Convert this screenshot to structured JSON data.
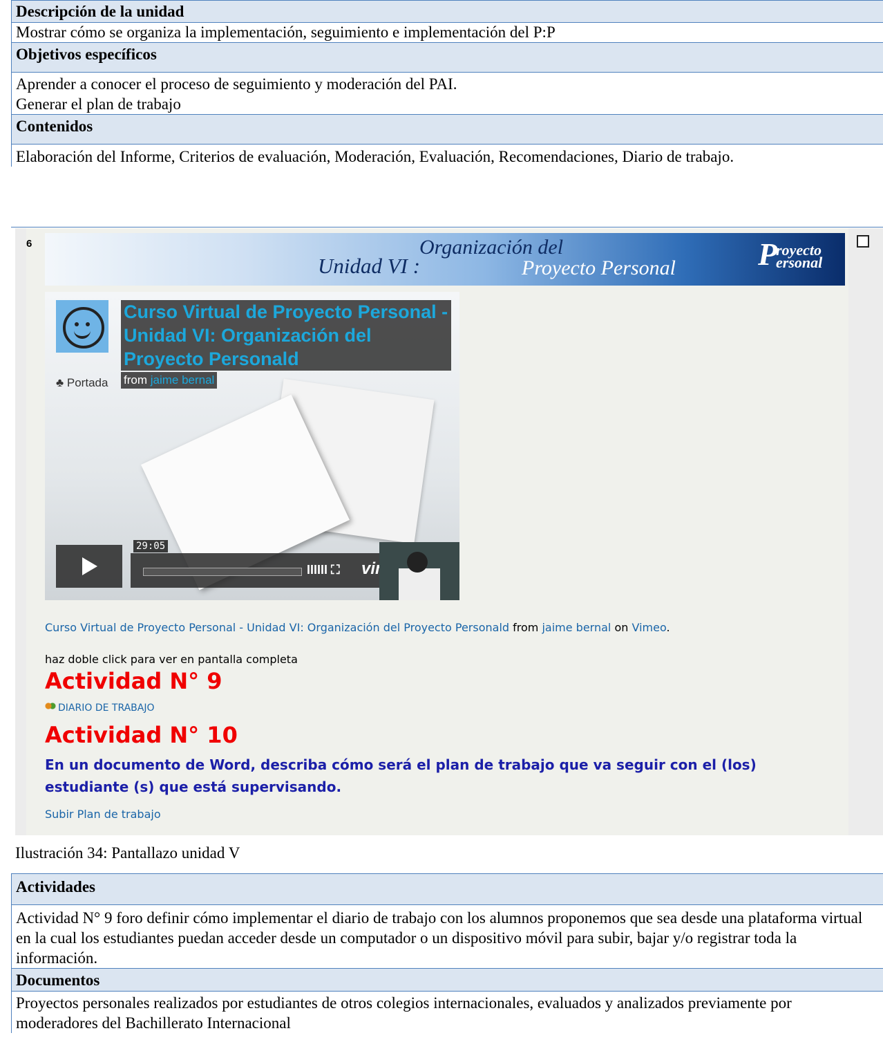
{
  "sections": {
    "descripcion": {
      "heading": "Descripción de la unidad",
      "body": "Mostrar cómo se organiza la implementación, seguimiento e implementación del P:P"
    },
    "objetivos": {
      "heading": "Objetivos específicos",
      "lines": [
        "Aprender a conocer el proceso de seguimiento y moderación del PAI.",
        "Generar el plan de trabajo"
      ]
    },
    "contenidos": {
      "heading": "Contenidos",
      "body": "Elaboración del Informe, Criterios de evaluación, Moderación, Evaluación, Recomendaciones, Diario de trabajo."
    },
    "actividades": {
      "heading": "Actividades",
      "body": "Actividad N° 9 foro definir cómo implementar el diario de trabajo con los alumnos proponemos que sea desde una plataforma virtual en la cual los estudiantes puedan acceder desde un computador o un dispositivo móvil para subir, bajar y/o registrar toda la información."
    },
    "documentos": {
      "heading": "Documentos",
      "body": "Proyectos personales realizados por estudiantes de otros colegios internacionales, evaluados y analizados previamente por moderadores del Bachillerato Internacional"
    }
  },
  "screenshot": {
    "section_number": "6",
    "banner": {
      "unidad": "Unidad VI :",
      "line1": "Organización del",
      "line2": "Proyecto Personal",
      "logo_p": "P",
      "logo_top": "royecto",
      "logo_bottom": "ersonal"
    },
    "video": {
      "title": "Curso Virtual de Proyecto Personal - Unidad VI: Organización del Proyecto Personald",
      "from_label": "from",
      "author": "jaime bernal",
      "portada": "Portada",
      "time": "29:05",
      "brand": "vimeo",
      "icons": "IIIIII ⛶"
    },
    "caption": {
      "link1": "Curso Virtual de Proyecto Personal - Unidad VI: Organización del Proyecto Personald",
      "from": "from",
      "author": "jaime bernal",
      "on": "on",
      "site": "Vimeo"
    },
    "hint": "haz doble click para ver en pantalla completa",
    "activity9": "Actividad N° 9",
    "diario_link": "DIARIO DE TRABAJO",
    "activity10": "Actividad N° 10",
    "instruction": "En un documento de Word, describa cómo será el plan de trabajo que va seguir con el (los) estudiante (s) que está supervisando.",
    "subir_link": "Subir Plan de trabajo"
  },
  "figure_caption": "Ilustración 34: Pantallazo unidad V",
  "colors": {
    "header_bg": "#dbe5f1",
    "rule": "#4f81bd",
    "activity_red": "#f00000",
    "link_blue": "#1a65a8",
    "instruction_blue": "#1b1fa8"
  }
}
